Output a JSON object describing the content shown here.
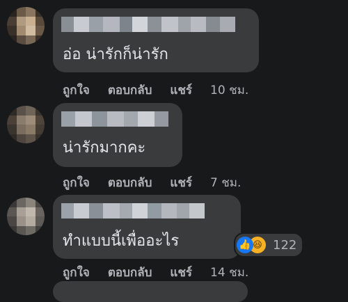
{
  "comments": [
    {
      "text": "อ่อ น่ารักก็น่ารัก",
      "actions": {
        "like": "ถูกใจ",
        "reply": "ตอบกลับ",
        "share": "แชร์",
        "time": "10 ชม."
      }
    },
    {
      "text": "น่ารักมากคะ",
      "actions": {
        "like": "ถูกใจ",
        "reply": "ตอบกลับ",
        "share": "แชร์",
        "time": "7 ชม."
      }
    },
    {
      "text": "ทำแบบนี้เพื่ออะไร",
      "actions": {
        "like": "ถูกใจ",
        "reply": "ตอบกลับ",
        "share": "แชร์",
        "time": "14 ชม."
      },
      "reactions": {
        "icons": [
          "like-icon",
          "haha-icon"
        ],
        "count": "122"
      }
    }
  ],
  "colors": {
    "background": "#18191a",
    "bubble": "#3a3b3c",
    "text": "#e4e6eb",
    "secondary": "#b0b3b8",
    "like": "#1877f2",
    "haha": "#f7b125"
  }
}
